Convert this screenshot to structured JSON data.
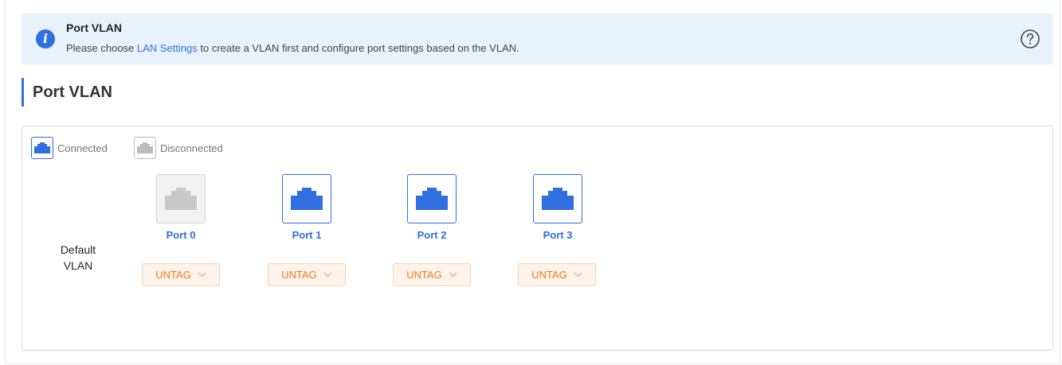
{
  "banner": {
    "icon": "info-icon",
    "title": "Port VLAN",
    "text_before": "Please choose ",
    "link_text": "LAN Settings",
    "text_after": " to create a VLAN first and configure port settings based on the VLAN.",
    "help_icon": "question-circle-icon"
  },
  "section": {
    "title": "Port VLAN"
  },
  "legend": {
    "connected": "Connected",
    "disconnected": "Disconnected"
  },
  "ports": [
    {
      "label": "Port 0",
      "status": "disconnected"
    },
    {
      "label": "Port 1",
      "status": "connected"
    },
    {
      "label": "Port 2",
      "status": "connected"
    },
    {
      "label": "Port 3",
      "status": "connected"
    }
  ],
  "vlan_row": {
    "label_line1": "Default",
    "label_line2": "VLAN",
    "values": [
      "UNTAG",
      "UNTAG",
      "UNTAG",
      "UNTAG"
    ]
  },
  "colors": {
    "accent": "#2f6fe0",
    "banner_bg": "#e8f2fd",
    "untag_text": "#f07b19",
    "untag_bg": "#fdf3ea",
    "disconnected": "#c8c8c8"
  }
}
